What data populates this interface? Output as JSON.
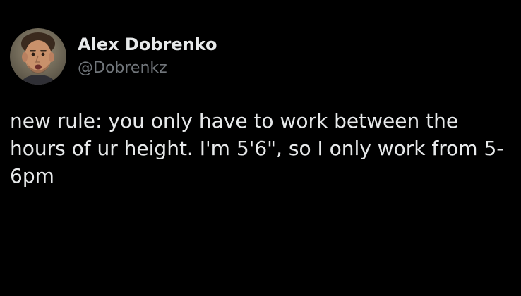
{
  "tweet": {
    "author": {
      "display_name": "Alex Dobrenko",
      "handle": "@Dobrenkz",
      "avatar_icon": "avatar-photo-icon"
    },
    "text": "new rule: you only have to work between the hours of ur height. I'm 5'6\", so I only work from 5-6pm"
  },
  "colors": {
    "background": "#000000",
    "primary_text": "#e7e9ea",
    "secondary_text": "#71767b"
  }
}
